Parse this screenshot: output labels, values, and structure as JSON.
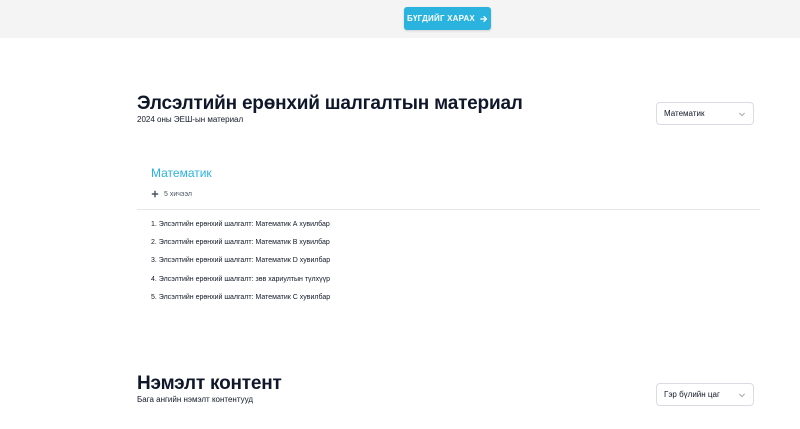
{
  "top_bar": {
    "cta_label": "БҮГДИЙГ ХАРАХ"
  },
  "section1": {
    "title": "Элсэлтийн ерөнхий шалгалтын материал",
    "subtitle": "2024 оны ЭЕШ-ын материал",
    "select_value": "Математик",
    "subject": {
      "title": "Математик",
      "count_label": "5 хичээл",
      "items": [
        "1. Элсэлтийн ерөнхий шалгалт: Математик А хувилбар",
        "2. Элсэлтийн ерөнхий шалгалт: Математик В хувилбар",
        "3. Элсэлтийн ерөнхий шалгалт: Математик D хувилбар",
        "4. Элсэлтийн ерөнхий шалгалт: зөв хариултын түлхүүр",
        "5. Элсэлтийн ерөнхий шалгалт: Математик С хувилбар"
      ]
    }
  },
  "section2": {
    "title": "Нэмэлт контент",
    "subtitle": "Бага ангийн нэмэлт контентууд",
    "select_value": "Гэр бүлийн цаг"
  },
  "icons": {
    "cta": "arrow-right-icon",
    "select": "chevron-down-icon",
    "count": "plus-icon"
  },
  "colors": {
    "accent": "#2ab3df",
    "top_band": "#f4f4f5",
    "heading": "#0f172a"
  }
}
